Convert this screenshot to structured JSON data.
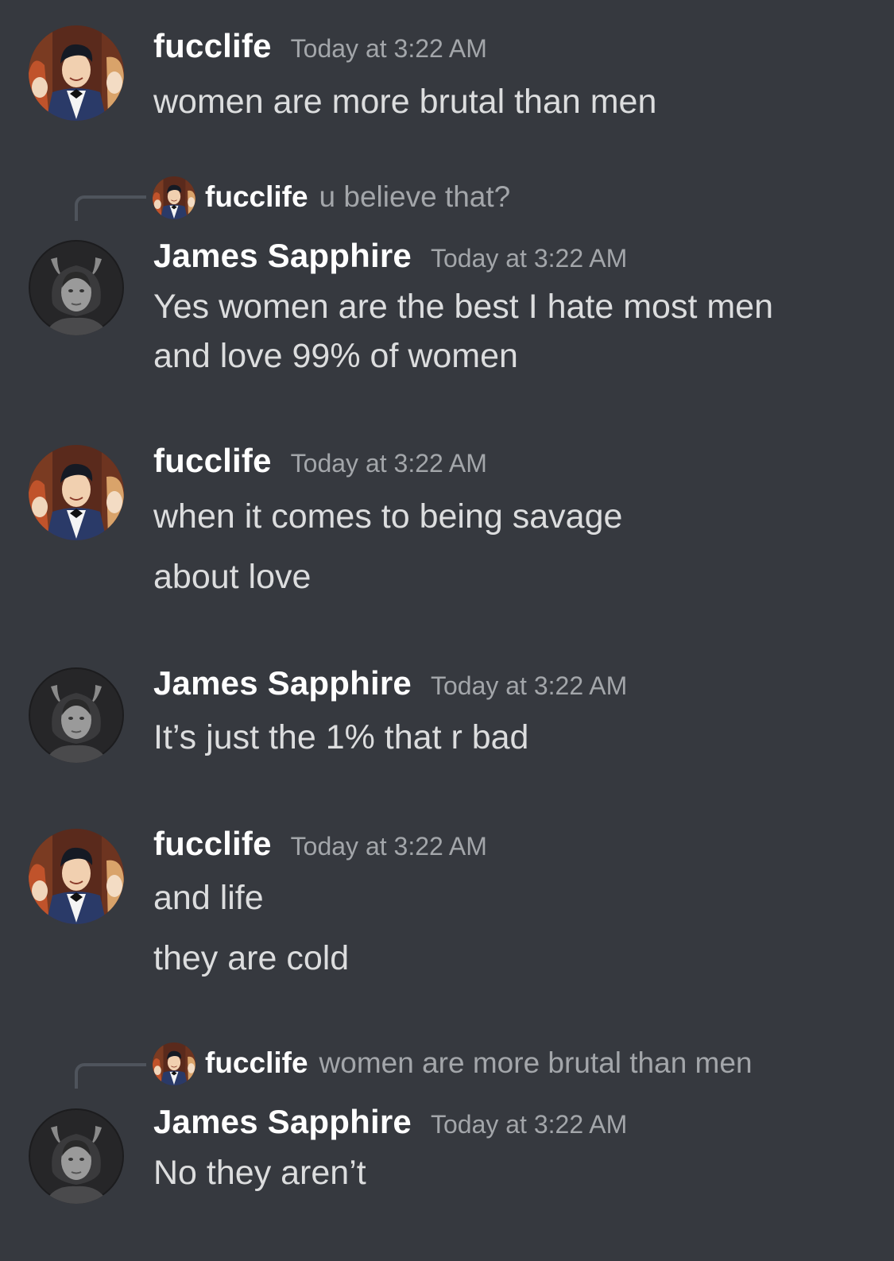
{
  "messages": [
    {
      "user": "fucclife",
      "time": "Today at 3:22 AM",
      "lines": [
        "women are more brutal than men"
      ]
    },
    {
      "reply": {
        "user": "fucclife",
        "text": "u believe that?"
      },
      "user": "James Sapphire",
      "time": "Today at 3:22 AM",
      "lines": [
        "Yes women are the best I hate most men",
        "and love 99% of women"
      ]
    },
    {
      "user": "fucclife",
      "time": "Today at 3:22 AM",
      "lines": [
        "when it comes to being savage",
        "about love"
      ]
    },
    {
      "user": "James Sapphire",
      "time": "Today at 3:22 AM",
      "lines": [
        "It’s just the 1% that r bad"
      ]
    },
    {
      "user": "fucclife",
      "time": "Today at 3:22 AM",
      "lines": [
        "and life",
        "they are cold"
      ]
    },
    {
      "reply": {
        "user": "fucclife",
        "text": "women are more brutal than men"
      },
      "user": "James Sapphire",
      "time": "Today at 3:22 AM",
      "lines": [
        "No they aren’t"
      ]
    }
  ],
  "colors": {
    "background": "#36393f",
    "username": "#ffffff",
    "timestamp": "#a3a6aa",
    "message_text": "#dcddde",
    "reply_spine": "#4f545c"
  }
}
